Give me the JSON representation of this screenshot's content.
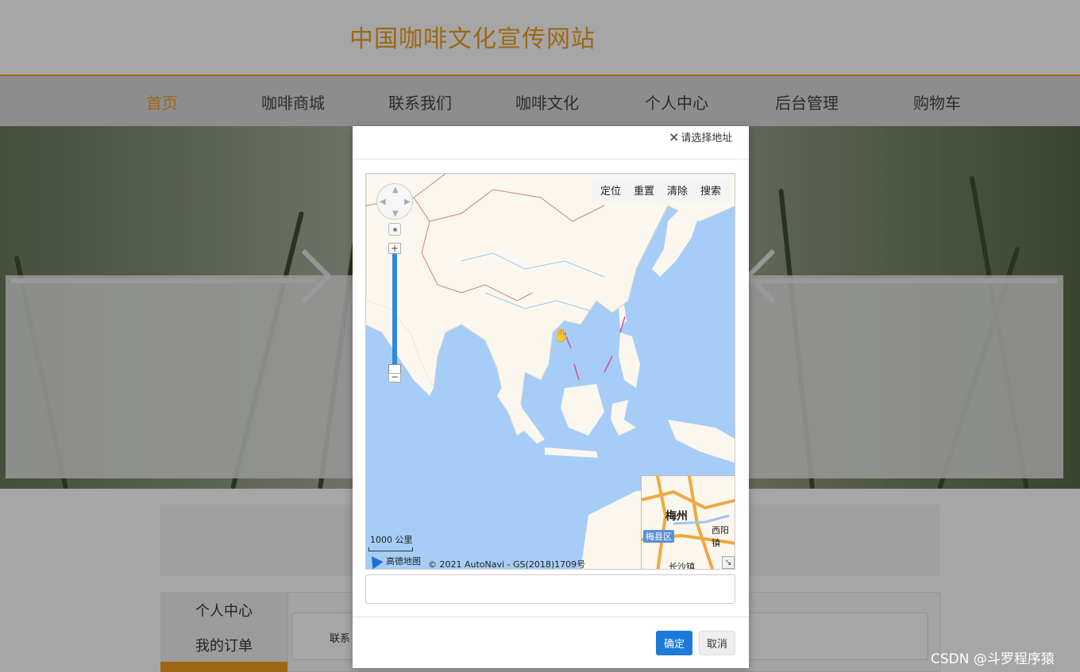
{
  "header": {
    "title": "中国咖啡文化宣传网站"
  },
  "nav": {
    "items": [
      {
        "label": "首页",
        "active": true
      },
      {
        "label": "咖啡商城"
      },
      {
        "label": "联系我们"
      },
      {
        "label": "咖啡文化"
      },
      {
        "label": "个人中心"
      },
      {
        "label": "后台管理"
      },
      {
        "label": "购物车"
      }
    ]
  },
  "sidebar": {
    "items": [
      {
        "label": "个人中心"
      },
      {
        "label": "我的订单"
      }
    ]
  },
  "content": {
    "contact_label": "联系"
  },
  "dialog": {
    "close_label": "请选择地址",
    "map": {
      "toolbar": [
        {
          "label": "定位"
        },
        {
          "label": "重置"
        },
        {
          "label": "清除"
        },
        {
          "label": "搜索"
        }
      ],
      "scale_label": "1000 公里",
      "logo_text": "高德地图",
      "copyright": "© 2021 AutoNavi - GS(2018)1709号",
      "overview": {
        "city": "梅州",
        "east": "西阳镇",
        "district": "梅县区",
        "town": "长沙镇"
      }
    },
    "address_value": "",
    "confirm_label": "确定",
    "cancel_label": "取消"
  },
  "watermark": "CSDN @斗罗程序猿",
  "colors": {
    "accent": "#f0a020",
    "primary_button": "#1e7ad8",
    "sea": "#a5cdf7",
    "land": "#fbf7ee"
  }
}
